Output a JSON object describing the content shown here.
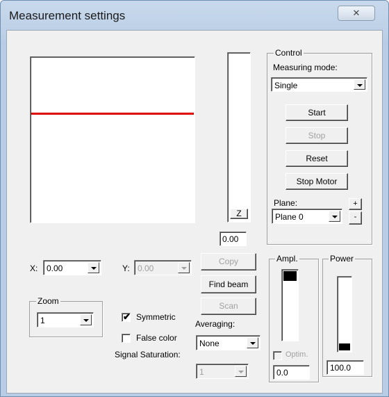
{
  "window": {
    "title": "Measurement settings",
    "close_glyph": "✕"
  },
  "preview": {
    "line_color": "#e00000"
  },
  "z_slider": {
    "label": "Z",
    "value": "0.00"
  },
  "control": {
    "legend": "Control",
    "mode_label": "Measuring mode:",
    "mode_value": "Single",
    "start": "Start",
    "stop": "Stop",
    "reset": "Reset",
    "stop_motor": "Stop Motor",
    "plane_label": "Plane:",
    "plane_value": "Plane 0",
    "plane_up": "+",
    "plane_down": "-"
  },
  "coords": {
    "x_label": "X:",
    "x_value": "0.00",
    "y_label": "Y:",
    "y_value": "0.00"
  },
  "zoom": {
    "legend": "Zoom",
    "value": "1"
  },
  "options": {
    "symmetric": "Symmetric",
    "symmetric_checked": true,
    "false_color": "False color",
    "false_color_checked": false,
    "signal_saturation": "Signal Saturation:",
    "saturation_value": "1"
  },
  "actions": {
    "copy": "Copy",
    "find_beam": "Find beam",
    "scan": "Scan",
    "averaging_label": "Averaging:",
    "averaging_value": "None"
  },
  "ampl": {
    "legend": "Ampl.",
    "optim": "Optim.",
    "value": "0.0",
    "level": 0.1
  },
  "power": {
    "legend": "Power",
    "value": "100.0",
    "level": 0.1
  }
}
